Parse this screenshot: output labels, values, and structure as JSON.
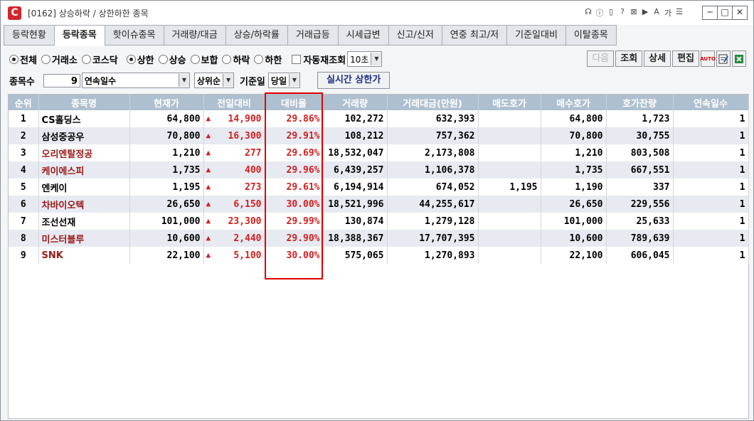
{
  "window": {
    "title": "[0162] 상승하락 / 상한하한 종목",
    "toolbar_icons": [
      "headset-icon",
      "info-icon",
      "chat-icon",
      "help-icon",
      "link-icon",
      "flag-icon",
      "font-icon",
      "hangul-icon",
      "menu-icon"
    ],
    "toolbar_glyphs": [
      "☊",
      "ⓘ",
      "▯",
      "?",
      "⊠",
      "▶",
      "A",
      "가",
      "☰"
    ],
    "minimize": "─",
    "maximize": "□",
    "close": "✕"
  },
  "tabs": [
    "등락현황",
    "등락종목",
    "핫이슈종목",
    "거래량/대금",
    "상승/하락률",
    "거래급등",
    "시세급변",
    "신고/신저",
    "연중 최고/저",
    "기준일대비",
    "이탈종목"
  ],
  "active_tab": 1,
  "filters": {
    "market": [
      "전체",
      "거래소",
      "코스닥"
    ],
    "market_selected": 0,
    "change_type": [
      "상한",
      "상승",
      "보합",
      "하락",
      "하한"
    ],
    "change_selected": 0,
    "auto_query_label": "자동재조회",
    "auto_interval": "10초"
  },
  "actions": {
    "next": "다음",
    "query": "조회",
    "detail": "상세",
    "edit": "편집",
    "auto": "AUTO"
  },
  "row2": {
    "count_label": "종목수",
    "count_value": "9",
    "sort_field": "연속일수",
    "sort_order": "상위순",
    "base_date_label": "기준일",
    "base_date_value": "당일",
    "realtime_button": "실시간 상한가"
  },
  "table": {
    "headers": [
      "순위",
      "종목명",
      "현재가",
      "전일대비",
      "대비율",
      "거래량",
      "거래대금(만원)",
      "매도호가",
      "매수호가",
      "호가잔량",
      "연속일수"
    ],
    "rows": [
      {
        "rank": "1",
        "name": "CS홀딩스",
        "price": "64,800",
        "diff": "14,900",
        "rate": "29.86%",
        "volume": "102,272",
        "amount": "632,393",
        "ask": "",
        "bid": "64,800",
        "remain": "1,723",
        "days": "1",
        "name_color": "black"
      },
      {
        "rank": "2",
        "name": "삼성중공우",
        "price": "70,800",
        "diff": "16,300",
        "rate": "29.91%",
        "volume": "108,212",
        "amount": "757,362",
        "ask": "",
        "bid": "70,800",
        "remain": "30,755",
        "days": "1",
        "name_color": "black"
      },
      {
        "rank": "3",
        "name": "오리엔탈정공",
        "price": "1,210",
        "diff": "277",
        "rate": "29.69%",
        "volume": "18,532,047",
        "amount": "2,173,808",
        "ask": "",
        "bid": "1,210",
        "remain": "803,508",
        "days": "1",
        "name_color": "red"
      },
      {
        "rank": "4",
        "name": "케이에스피",
        "price": "1,735",
        "diff": "400",
        "rate": "29.96%",
        "volume": "6,439,257",
        "amount": "1,106,378",
        "ask": "",
        "bid": "1,735",
        "remain": "667,551",
        "days": "1",
        "name_color": "red"
      },
      {
        "rank": "5",
        "name": "엔케이",
        "price": "1,195",
        "diff": "273",
        "rate": "29.61%",
        "volume": "6,194,914",
        "amount": "674,052",
        "ask": "1,195",
        "bid": "1,190",
        "remain": "337",
        "days": "1",
        "name_color": "black"
      },
      {
        "rank": "6",
        "name": "차바이오텍",
        "price": "26,650",
        "diff": "6,150",
        "rate": "30.00%",
        "volume": "18,521,996",
        "amount": "44,255,617",
        "ask": "",
        "bid": "26,650",
        "remain": "229,556",
        "days": "1",
        "name_color": "red"
      },
      {
        "rank": "7",
        "name": "조선선재",
        "price": "101,000",
        "diff": "23,300",
        "rate": "29.99%",
        "volume": "130,874",
        "amount": "1,279,128",
        "ask": "",
        "bid": "101,000",
        "remain": "25,633",
        "days": "1",
        "name_color": "black"
      },
      {
        "rank": "8",
        "name": "미스터블루",
        "price": "10,600",
        "diff": "2,440",
        "rate": "29.90%",
        "volume": "18,388,367",
        "amount": "17,707,395",
        "ask": "",
        "bid": "10,600",
        "remain": "789,639",
        "days": "1",
        "name_color": "red"
      },
      {
        "rank": "9",
        "name": "SNK",
        "price": "22,100",
        "diff": "5,100",
        "rate": "30.00%",
        "volume": "575,065",
        "amount": "1,270,893",
        "ask": "",
        "bid": "22,100",
        "remain": "606,045",
        "days": "1",
        "name_color": "red"
      }
    ],
    "up_glyph": "▲"
  },
  "colors": {
    "up": "#d41e1e",
    "name_red": "#9a1818",
    "header_bg": "#aebfcf",
    "highlight_box": "#e00000",
    "brand": "#d2272e"
  }
}
